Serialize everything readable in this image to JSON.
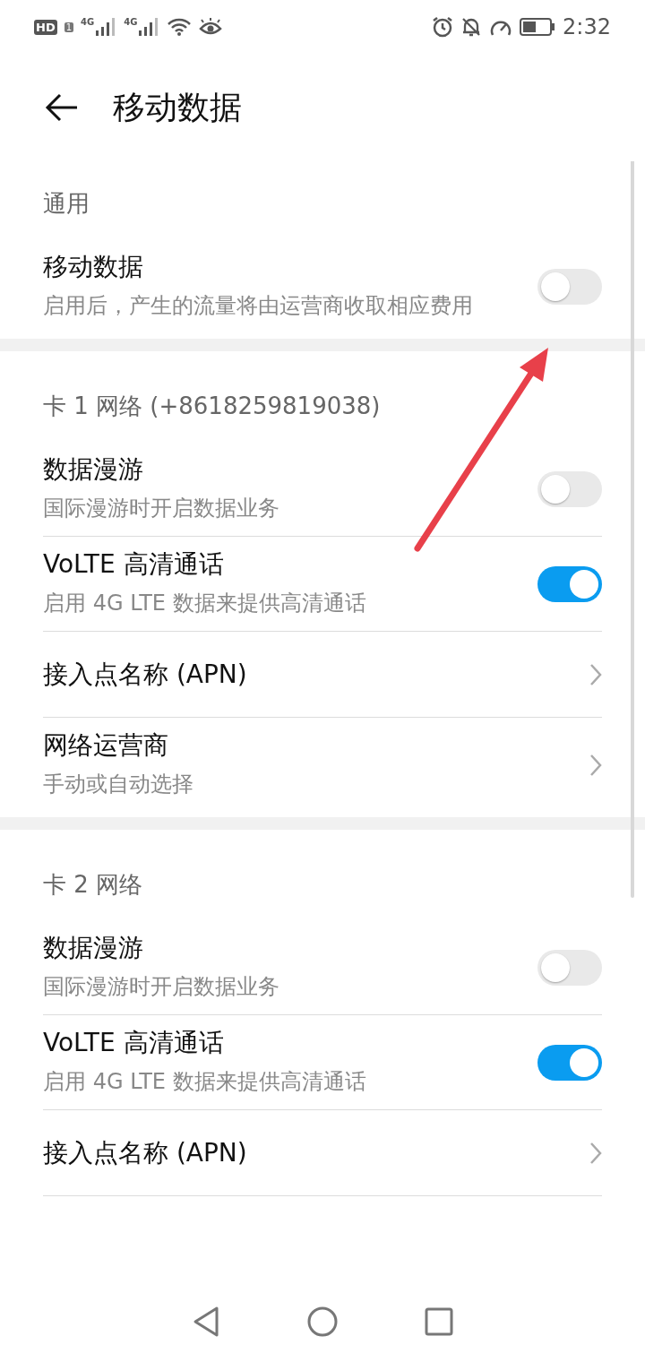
{
  "status_bar": {
    "hd_badge": "HD",
    "sim_badge": "1",
    "network_labels": [
      "4G",
      "4G"
    ],
    "time": "2:32"
  },
  "header": {
    "title": "移动数据"
  },
  "sections": [
    {
      "title": "通用",
      "items": [
        {
          "kind": "toggle",
          "title": "移动数据",
          "subtitle": "启用后，产生的流量将由运营商收取相应费用",
          "on": false
        }
      ]
    },
    {
      "title": "卡 1 网络 (+8618259819038)",
      "items": [
        {
          "kind": "toggle",
          "title": "数据漫游",
          "subtitle": "国际漫游时开启数据业务",
          "on": false
        },
        {
          "kind": "toggle",
          "title": "VoLTE 高清通话",
          "subtitle": "启用 4G LTE 数据来提供高清通话",
          "on": true
        },
        {
          "kind": "link",
          "title": "接入点名称 (APN)"
        },
        {
          "kind": "link",
          "title": "网络运营商",
          "subtitle": "手动或自动选择"
        }
      ]
    },
    {
      "title": "卡 2 网络",
      "items": [
        {
          "kind": "toggle",
          "title": "数据漫游",
          "subtitle": "国际漫游时开启数据业务",
          "on": false
        },
        {
          "kind": "toggle",
          "title": "VoLTE 高清通话",
          "subtitle": "启用 4G LTE 数据来提供高清通话",
          "on": true
        },
        {
          "kind": "link",
          "title": "接入点名称 (APN)"
        }
      ]
    }
  ]
}
